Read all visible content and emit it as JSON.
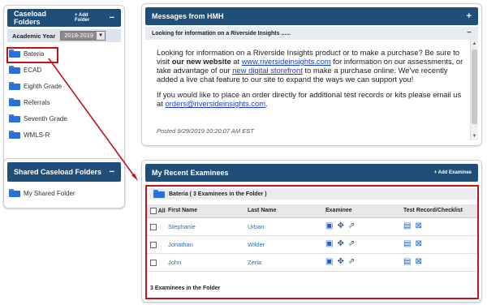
{
  "caseload": {
    "title": "Caseload Folders",
    "add_label": "+ Add Folder",
    "collapse_symbol": "−",
    "year_label": "Academic Year",
    "year_value": "2018-2019",
    "folders": [
      {
        "label": "Bateria"
      },
      {
        "label": "ECAD"
      },
      {
        "label": "Eighth Grade"
      },
      {
        "label": "Referrals"
      },
      {
        "label": "Seventh Grade"
      },
      {
        "label": "WMLS-R"
      }
    ]
  },
  "shared": {
    "title": "Shared Caseload Folders",
    "collapse_symbol": "−",
    "folder_label": "My Shared Folder"
  },
  "messages": {
    "title": "Messages from HMH",
    "expand_symbol": "+",
    "subject": "Looking for information on a Riverside Insights ......",
    "subject_symbol": "−",
    "p1_a": "Looking for information on a Riverside Insights product or to make a purchase? Be sure to visit ",
    "p1_bold": "our new website",
    "p1_b": " at ",
    "p1_link1": "www.riversideinsights.com",
    "p1_c": " for information on our assessments, or take advantage of our ",
    "p1_link2": "new digital storefront",
    "p1_d": " to make a purchase online. We've recently added a live chat feature to our site to expand the ways we can support you!",
    "p2_a": "If you would like to place an order directly for additional test records or kits please email us at ",
    "p2_link": "orders@riversideinsights.com",
    "p2_b": ".",
    "posted": "Posted 9/29/2019 10:20:07 AM EST"
  },
  "recent": {
    "title": "My Recent Examinees",
    "add_label": "+ Add Examinee",
    "add_symbol": "+",
    "group_label": "Bateria ( 3 Examinees in the Folder )",
    "columns": {
      "all": "All",
      "first": "First Name",
      "last": "Last Name",
      "examinee": "Examinee",
      "record": "Test Record/Checklist"
    },
    "rows": [
      {
        "first": "Stephanie",
        "last": "Urban"
      },
      {
        "first": "Jonathan",
        "last": "Wilder"
      },
      {
        "first": "John",
        "last": "Zerla"
      }
    ],
    "footer": "3 Examinees in the Folder"
  },
  "colors": {
    "header": "#1f4e79",
    "highlight": "#c0141b",
    "link": "#1a3cc8"
  }
}
